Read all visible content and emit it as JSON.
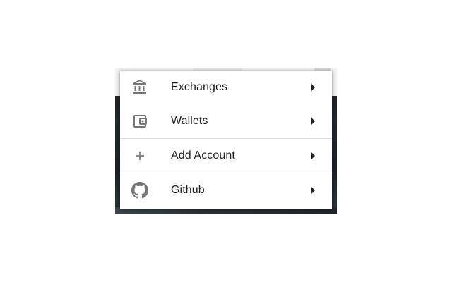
{
  "menu": {
    "items": [
      {
        "label": "Exchanges",
        "icon": "bank-icon"
      },
      {
        "label": "Wallets",
        "icon": "wallet-icon"
      },
      {
        "label": "Add Account",
        "icon": "plus-icon"
      },
      {
        "label": "Github",
        "icon": "github-icon"
      }
    ]
  },
  "colors": {
    "text": "#212121",
    "icon": "#757575",
    "divider": "#e0e0e0"
  }
}
